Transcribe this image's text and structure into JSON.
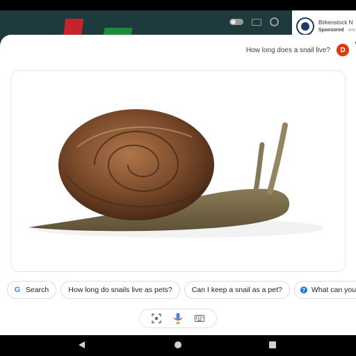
{
  "background_app": {
    "ad": {
      "name": "Birkenstock N",
      "sponsored_label": "Sponsored",
      "sponsored_suffix": " · ww"
    }
  },
  "assistant": {
    "query": "How long does a snail live?",
    "avatar_initial": "D",
    "avatar_color": "#d93b0e",
    "image_subject": "snail"
  },
  "suggestions": [
    {
      "label": "Search",
      "icon": "google-g-icon"
    },
    {
      "label": "How long do snails live as pets?",
      "icon": ""
    },
    {
      "label": "Can I keep a snail as a pet?",
      "icon": ""
    },
    {
      "label": "What can you do",
      "icon": "help-icon"
    }
  ],
  "toolbar": {
    "icons": [
      "lens-icon",
      "microphone-icon",
      "keyboard-icon"
    ]
  },
  "navigation": {
    "icons": [
      "back-icon",
      "home-icon",
      "recents-icon"
    ]
  }
}
